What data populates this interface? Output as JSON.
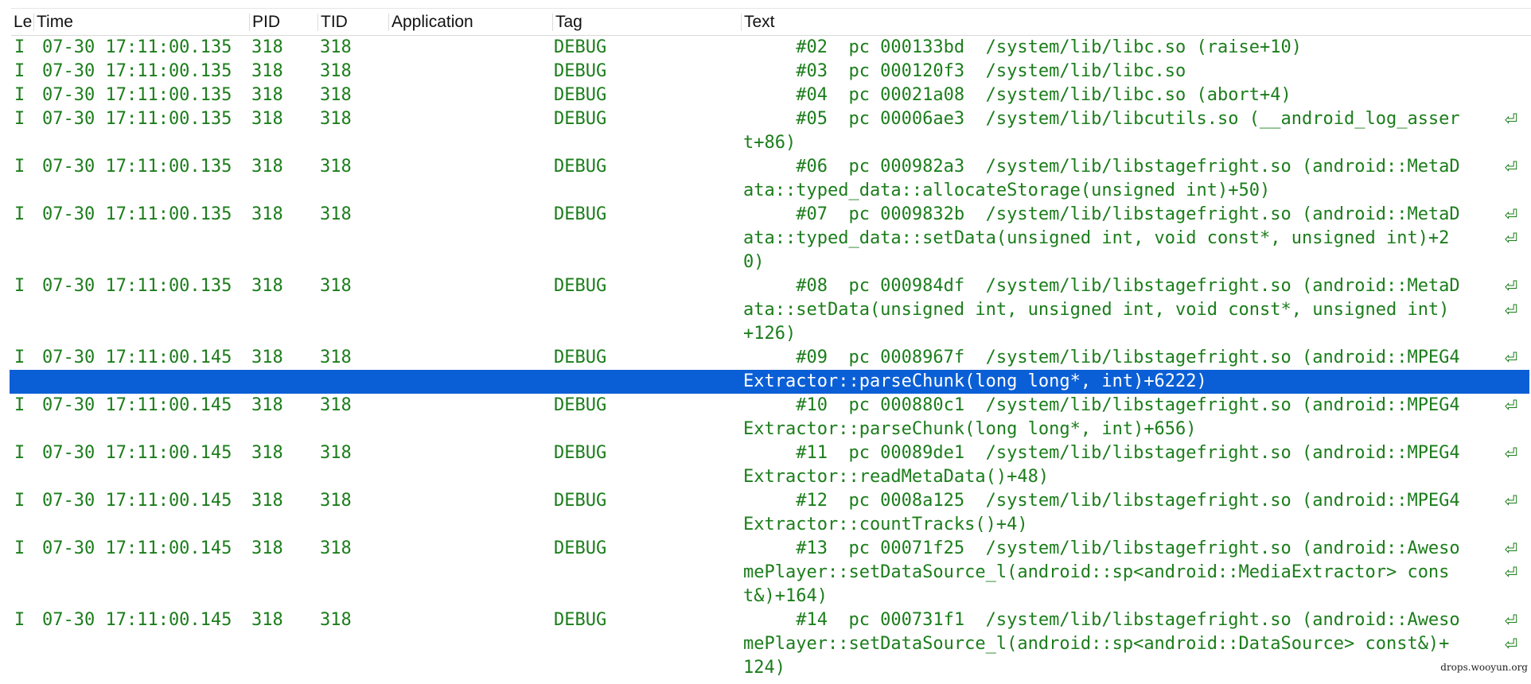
{
  "columns": {
    "level": "Le",
    "time": "Time",
    "pid": "PID",
    "tid": "TID",
    "application": "Application",
    "tag": "Tag",
    "text": "Text"
  },
  "rows": [
    {
      "level": "I",
      "time": "07-30 17:11:00.135",
      "pid": "318",
      "tid": "318",
      "application": "",
      "tag": "DEBUG",
      "lines": [
        "     #02  pc 000133bd  /system/lib/libc.so (raise+10)"
      ]
    },
    {
      "level": "I",
      "time": "07-30 17:11:00.135",
      "pid": "318",
      "tid": "318",
      "application": "",
      "tag": "DEBUG",
      "lines": [
        "     #03  pc 000120f3  /system/lib/libc.so"
      ]
    },
    {
      "level": "I",
      "time": "07-30 17:11:00.135",
      "pid": "318",
      "tid": "318",
      "application": "",
      "tag": "DEBUG",
      "lines": [
        "     #04  pc 00021a08  /system/lib/libc.so (abort+4)"
      ]
    },
    {
      "level": "I",
      "time": "07-30 17:11:00.135",
      "pid": "318",
      "tid": "318",
      "application": "",
      "tag": "DEBUG",
      "lines": [
        "     #05  pc 00006ae3  /system/lib/libcutils.so (__android_log_asser",
        "t+86)"
      ]
    },
    {
      "level": "I",
      "time": "07-30 17:11:00.135",
      "pid": "318",
      "tid": "318",
      "application": "",
      "tag": "DEBUG",
      "lines": [
        "     #06  pc 000982a3  /system/lib/libstagefright.so (android::MetaD",
        "ata::typed_data::allocateStorage(unsigned int)+50)"
      ]
    },
    {
      "level": "I",
      "time": "07-30 17:11:00.135",
      "pid": "318",
      "tid": "318",
      "application": "",
      "tag": "DEBUG",
      "lines": [
        "     #07  pc 0009832b  /system/lib/libstagefright.so (android::MetaD",
        "ata::typed_data::setData(unsigned int, void const*, unsigned int)+2",
        "0)"
      ]
    },
    {
      "level": "I",
      "time": "07-30 17:11:00.135",
      "pid": "318",
      "tid": "318",
      "application": "",
      "tag": "DEBUG",
      "lines": [
        "     #08  pc 000984df  /system/lib/libstagefright.so (android::MetaD",
        "ata::setData(unsigned int, unsigned int, void const*, unsigned int)",
        "+126)"
      ]
    },
    {
      "level": "I",
      "time": "07-30 17:11:00.145",
      "pid": "318",
      "tid": "318",
      "application": "",
      "tag": "DEBUG",
      "selected_line": 1,
      "lines": [
        "     #09  pc 0008967f  /system/lib/libstagefright.so (android::MPEG4",
        "Extractor::parseChunk(long long*, int)+6222)"
      ]
    },
    {
      "level": "I",
      "time": "07-30 17:11:00.145",
      "pid": "318",
      "tid": "318",
      "application": "",
      "tag": "DEBUG",
      "lines": [
        "     #10  pc 000880c1  /system/lib/libstagefright.so (android::MPEG4",
        "Extractor::parseChunk(long long*, int)+656)"
      ]
    },
    {
      "level": "I",
      "time": "07-30 17:11:00.145",
      "pid": "318",
      "tid": "318",
      "application": "",
      "tag": "DEBUG",
      "lines": [
        "     #11  pc 00089de1  /system/lib/libstagefright.so (android::MPEG4",
        "Extractor::readMetaData()+48)"
      ]
    },
    {
      "level": "I",
      "time": "07-30 17:11:00.145",
      "pid": "318",
      "tid": "318",
      "application": "",
      "tag": "DEBUG",
      "lines": [
        "     #12  pc 0008a125  /system/lib/libstagefright.so (android::MPEG4",
        "Extractor::countTracks()+4)"
      ]
    },
    {
      "level": "I",
      "time": "07-30 17:11:00.145",
      "pid": "318",
      "tid": "318",
      "application": "",
      "tag": "DEBUG",
      "lines": [
        "     #13  pc 00071f25  /system/lib/libstagefright.so (android::Aweso",
        "mePlayer::setDataSource_l(android::sp<android::MediaExtractor> cons",
        "t&)+164)"
      ]
    },
    {
      "level": "I",
      "time": "07-30 17:11:00.145",
      "pid": "318",
      "tid": "318",
      "application": "",
      "tag": "DEBUG",
      "lines": [
        "     #14  pc 000731f1  /system/lib/libstagefright.so (android::Aweso",
        "mePlayer::setDataSource_l(android::sp<android::DataSource> const&)+",
        "124)"
      ]
    }
  ],
  "wrap_glyph": "⏎",
  "colors": {
    "info_text": "#1b7d1b",
    "selection": "#0b5fd6"
  },
  "icons": {
    "wrap": "line-wrap-icon"
  },
  "watermark": "drops.wooyun.org"
}
